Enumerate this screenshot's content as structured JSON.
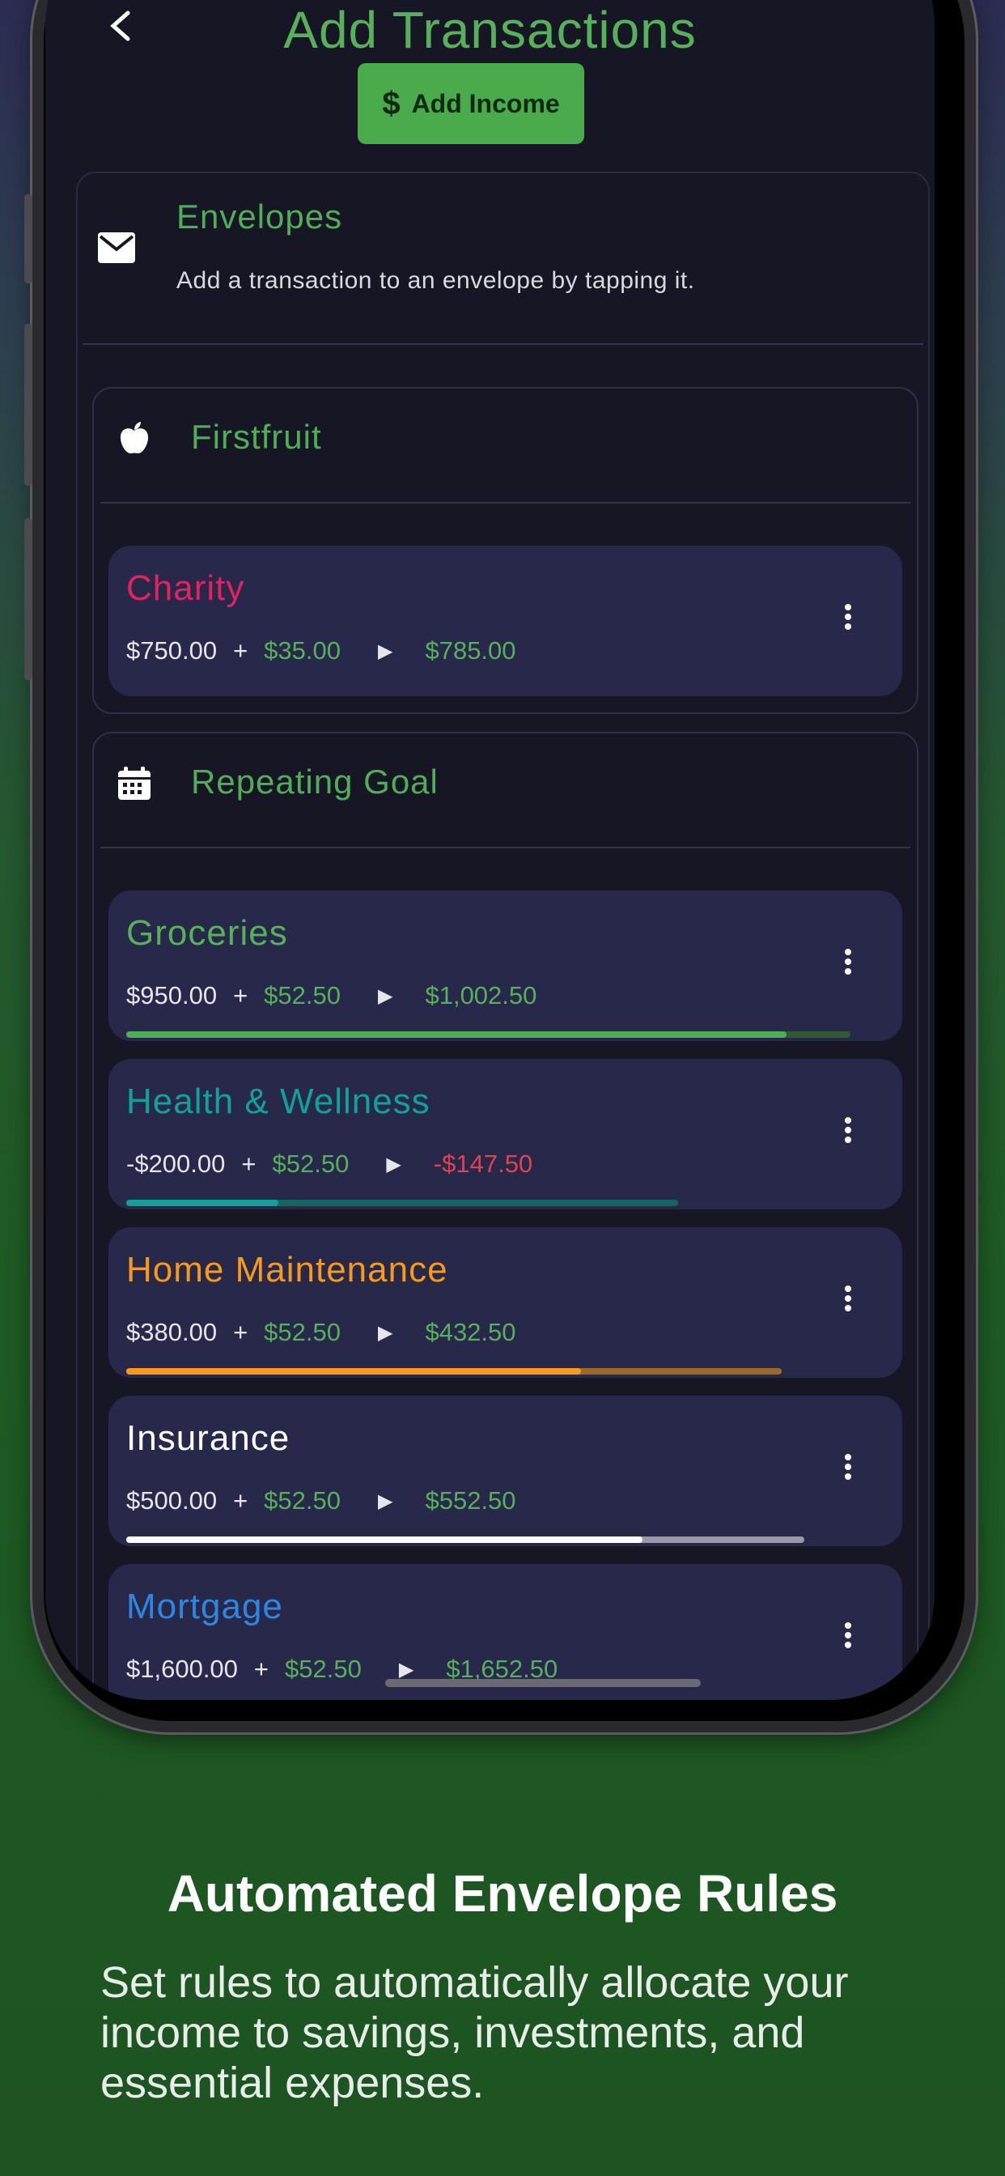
{
  "header": {
    "title": "Add Transactions",
    "income_button": "Add Income",
    "income_icon": "$"
  },
  "envelopes_panel": {
    "title": "Envelopes",
    "subtitle": "Add a transaction to an envelope by tapping it."
  },
  "groups": [
    {
      "title": "Firstfruit",
      "icon": "apple-icon",
      "items": [
        {
          "name": "Charity",
          "color": "#e0245e",
          "current": "$750.00",
          "plus": "+",
          "add": "$35.00",
          "result": "$785.00"
        }
      ]
    },
    {
      "title": "Repeating Goal",
      "icon": "calendar-icon",
      "items": [
        {
          "name": "Groceries",
          "color": "#56b15a",
          "current": "$950.00",
          "plus": "+",
          "add": "$52.50",
          "result": "$1,002.50",
          "progress_total": 0.93,
          "progress_fill": 0.86
        },
        {
          "name": "Health & Wellness",
          "color": "#12a19a",
          "current": "-$200.00",
          "plus": "+",
          "add": "$52.50",
          "result": "-$147.50",
          "progress_total": 0.71,
          "progress_fill": 0.2
        },
        {
          "name": "Home Maintenance",
          "color": "#f59a1c",
          "current": "$380.00",
          "plus": "+",
          "add": "$52.50",
          "result": "$432.50",
          "progress_total": 0.86,
          "progress_fill": 0.6
        },
        {
          "name": "Insurance",
          "color": "#ffffff",
          "current": "$500.00",
          "plus": "+",
          "add": "$52.50",
          "result": "$552.50",
          "progress_total": 0.88,
          "progress_fill": 0.68
        },
        {
          "name": "Mortgage",
          "color": "#2e86e0",
          "current": "$1,600.00",
          "plus": "+",
          "add": "$52.50",
          "result": "$1,652.50"
        }
      ]
    }
  ],
  "promo": {
    "headline": "Automated Envelope Rules",
    "tagline": "Set rules to automatically allocate your income to savings, investments, and essential expenses."
  },
  "colors": {
    "accent_green": "#56b15a",
    "negative_red": "#e2414f",
    "screen_bg": "#161625",
    "card_bg": "#28284a"
  }
}
